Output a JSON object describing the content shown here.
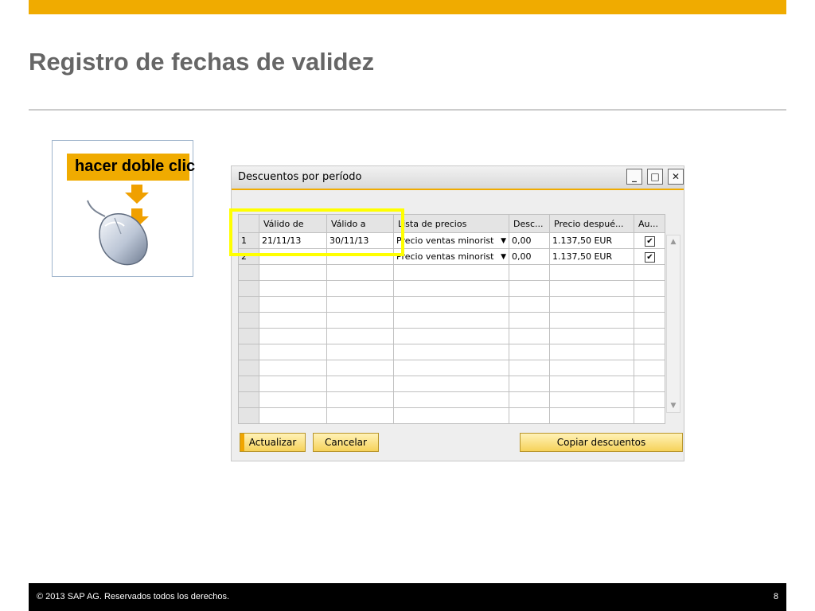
{
  "slide": {
    "title": "Registro de fechas de validez",
    "hint": "hacer doble clic",
    "footer": "©  2013 SAP AG. Reservados todos los derechos.",
    "page_number": "8"
  },
  "window": {
    "title": "Descuentos por período",
    "controls": [
      "minimize-icon",
      "maximize-icon",
      "close-icon"
    ]
  },
  "grid": {
    "columns": [
      "Válido de",
      "Válido a",
      "Lista de precios",
      "Desc...",
      "Precio despué...",
      "Au..."
    ],
    "rows": [
      {
        "n": "1",
        "valid_from": "21/11/13",
        "valid_to": "30/11/13",
        "price_list": "Precio ventas minorist",
        "discount": "0,00",
        "price_after": "1.137,50 EUR",
        "auto": true
      },
      {
        "n": "2",
        "valid_from": "",
        "valid_to": "",
        "price_list": "Precio ventas minorist",
        "discount": "0,00",
        "price_after": "1.137,50 EUR",
        "auto": true
      }
    ]
  },
  "buttons": {
    "update": "Actualizar",
    "cancel": "Cancelar",
    "copy": "Copiar descuentos"
  },
  "colors": {
    "accent": "#f0ab00",
    "highlight": "#ffff00",
    "footer": "#000000"
  }
}
